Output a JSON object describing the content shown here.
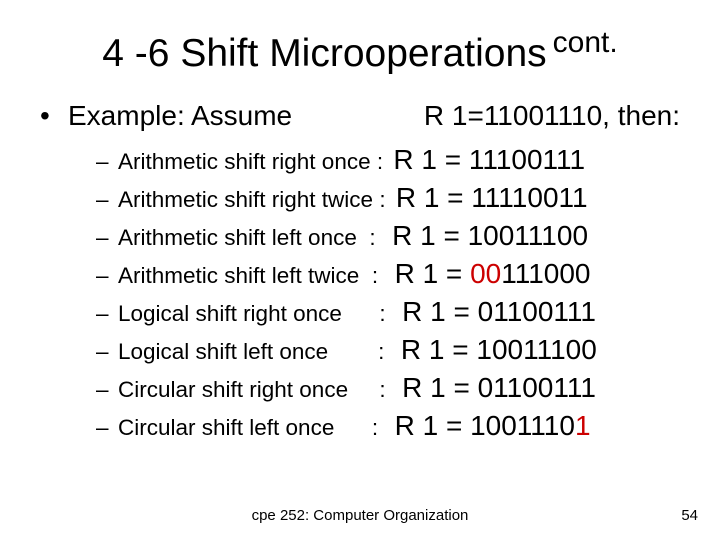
{
  "title": {
    "main": "4 -6 Shift Microoperations",
    "sup": "cont."
  },
  "example": {
    "bullet": "•",
    "prefix": "Example:  Assume",
    "cond": "R 1=11001110, then:"
  },
  "items": [
    {
      "dash": "–",
      "label": "Arithmetic shift right once : ",
      "result": "R 1 = 11100111"
    },
    {
      "dash": "–",
      "label": "Arithmetic shift right twice : ",
      "result": "R 1 = 11110011"
    },
    {
      "dash": "–",
      "label": "Arithmetic shift left once  :  ",
      "result": "R 1 = 10011100",
      "hl": {
        "start": 14,
        "end": 15
      }
    },
    {
      "dash": "–",
      "label": "Arithmetic shift left twice  :  ",
      "result": "R 1 = 00111000",
      "hl": {
        "start": 6,
        "end": 8
      }
    },
    {
      "dash": "–",
      "label": "Logical shift right once      :  ",
      "result": "R 1 = 01100111"
    },
    {
      "dash": "–",
      "label": "Logical shift left once        :  ",
      "result": "R 1 = 10011100"
    },
    {
      "dash": "–",
      "label": "Circular shift right once     :  ",
      "result": "R 1 = 01100111"
    },
    {
      "dash": "–",
      "label": "Circular shift left once      :  ",
      "result": "R 1 = 10011101",
      "hl": {
        "start": 13,
        "end": 14
      }
    }
  ],
  "footer": "cpe 252: Computer Organization",
  "page": "54"
}
